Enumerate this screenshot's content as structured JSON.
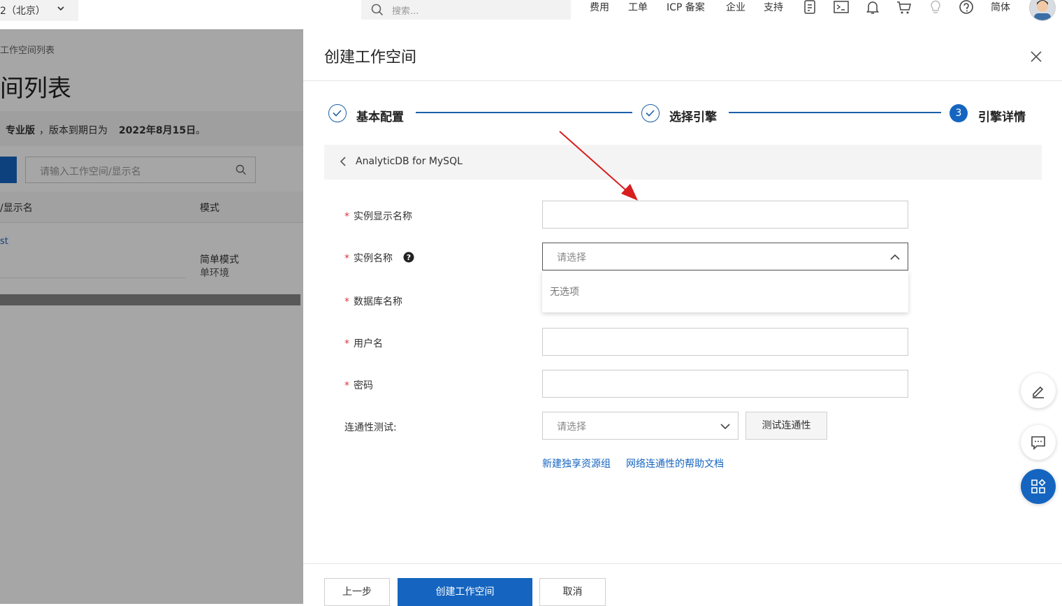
{
  "topbar": {
    "region": "2（北京）",
    "search_placeholder": "搜索...",
    "nav": [
      "费用",
      "工单",
      "ICP 备案",
      "企业",
      "支持"
    ],
    "lang": "简体"
  },
  "background_page": {
    "breadcrumb": "工作空间列表",
    "title": "间列表",
    "notice_prefix": "专业版",
    "notice_mid": "，版本到期日为",
    "notice_date": "2022年8月15日",
    "notice_end": "。",
    "search_placeholder": "请输入工作空间/显示名",
    "col_name": "/显示名",
    "col_mode": "模式",
    "row_link": "st",
    "row_mode": "简单模式",
    "row_env": "单环境"
  },
  "drawer": {
    "title": "创建工作空间",
    "steps": [
      {
        "label": "基本配置",
        "state": "done"
      },
      {
        "label": "选择引擎",
        "state": "done"
      },
      {
        "label": "引擎详情",
        "state": "active",
        "number": "3"
      }
    ],
    "engine": "AnalyticDB for MySQL",
    "fields": {
      "instance_display_name": {
        "label": "实例显示名称",
        "required": "*",
        "value": ""
      },
      "instance_name": {
        "label": "实例名称",
        "required": "*",
        "placeholder": "请选择",
        "dropdown_empty": "无选项"
      },
      "db_name": {
        "label": "数据库名称",
        "required": "*"
      },
      "username": {
        "label": "用户名",
        "required": "*",
        "value": ""
      },
      "password": {
        "label": "密码",
        "required": "*",
        "value": ""
      },
      "connectivity": {
        "label": "连通性测试:",
        "placeholder": "请选择",
        "test_button": "测试连通性"
      }
    },
    "links": [
      "新建独享资源组",
      "网络连通性的帮助文档"
    ],
    "footer": {
      "prev": "上一步",
      "create": "创建工作空间",
      "cancel": "取消"
    }
  },
  "colors": {
    "primary": "#1565c0",
    "required": "#d9363e",
    "arrow": "#d81e1e"
  }
}
